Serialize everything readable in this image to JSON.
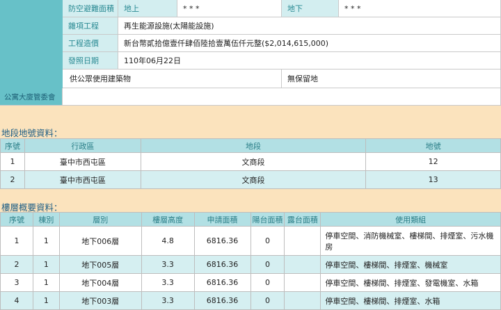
{
  "building_info": {
    "shelter_area_label": "防空避難面積",
    "above_label": "地上",
    "above_value": "* * *",
    "below_label": "地下",
    "below_value": "* * *",
    "misc_work_label": "雜項工程",
    "misc_work_value": "再生能源設施(太陽能設施)",
    "cost_label": "工程造價",
    "cost_value": "新台幣貳拾億壹仟肆佰陸拾壹萬伍仟元整($2,014,615,000)",
    "date_label": "發照日期",
    "date_value": "110年06月22日",
    "public_use": "供公眾使用建築物",
    "reserve": "無保留地",
    "committee_label": "公寓大廈管委會",
    "committee_value": ""
  },
  "land_section": {
    "title": "地段地號資料：",
    "headers": [
      "序號",
      "行政區",
      "地段",
      "地號"
    ],
    "rows": [
      [
        "1",
        "臺中市西屯區",
        "文商段",
        "12"
      ],
      [
        "2",
        "臺中市西屯區",
        "文商段",
        "13"
      ]
    ]
  },
  "floor_section": {
    "title": "樓層概要資料：",
    "headers": [
      "序號",
      "棟別",
      "層別",
      "樓層高度",
      "申請面積",
      "陽台面積",
      "露台面積",
      "使用類組"
    ],
    "rows": [
      [
        "1",
        "1",
        "地下006層",
        "4.8",
        "6816.36",
        "0",
        "",
        "停車空間、消防機械室、樓梯間、排煙室、污水機房"
      ],
      [
        "2",
        "1",
        "地下005層",
        "3.3",
        "6816.36",
        "0",
        "",
        "停車空間、樓梯間、排煙室、機械室"
      ],
      [
        "3",
        "1",
        "地下004層",
        "3.3",
        "6816.36",
        "0",
        "",
        "停車空間、樓梯間、排煙室、發電機室、水箱"
      ],
      [
        "4",
        "1",
        "地下003層",
        "3.3",
        "6816.36",
        "0",
        "",
        "停車空間、樓梯間、排煙室、水箱"
      ]
    ]
  }
}
